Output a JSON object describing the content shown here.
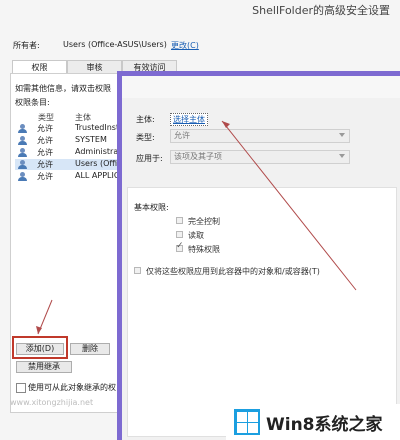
{
  "back_window": {
    "title": "ShellFolder的高级安全设置",
    "owner_label": "所有者:",
    "owner_value": "Users (Office-ASUS\\Users)",
    "owner_change_link": "更改(C)",
    "tabs": [
      {
        "label": "权限",
        "active": true
      },
      {
        "label": "审核",
        "active": false
      },
      {
        "label": "有效访问",
        "active": false
      }
    ],
    "info_text": "如需其他信息，请双击权限",
    "entries_label": "权限条目:",
    "columns": {
      "type": "类型",
      "principal": "主体"
    },
    "rows": [
      {
        "type": "允许",
        "principal": "TrustedInst"
      },
      {
        "type": "允许",
        "principal": "SYSTEM"
      },
      {
        "type": "允许",
        "principal": "Administrat"
      },
      {
        "type": "允许",
        "principal": "Users (Offic"
      },
      {
        "type": "允许",
        "principal": "ALL APPLIC"
      }
    ],
    "add_button": "添加(D)",
    "delete_button": "删除",
    "disable_inheritance_button": "禁用继承",
    "replace_checkbox_label": "使用可从此对象继承的权",
    "watermark": "www.xitongzhijia.net"
  },
  "front_window": {
    "principal_label": "主体:",
    "principal_link": "选择主体",
    "type_label": "类型:",
    "type_value": "允许",
    "applies_label": "应用于:",
    "applies_value": "该项及其子项",
    "basic_permissions_label": "基本权限:",
    "permissions": [
      {
        "label": "完全控制",
        "checked": false
      },
      {
        "label": "读取",
        "checked": false
      },
      {
        "label": "特殊权限",
        "checked": true
      }
    ],
    "apply_only_label": "仅将这些权限应用到此容器中的对象和/或容器(T)"
  },
  "logo": {
    "text": "Win8系统之家",
    "color": "#1b9fe0"
  },
  "colors": {
    "front_border": "#7d6ad1",
    "highlight": "#c0392b",
    "link": "#1a5fb4"
  }
}
